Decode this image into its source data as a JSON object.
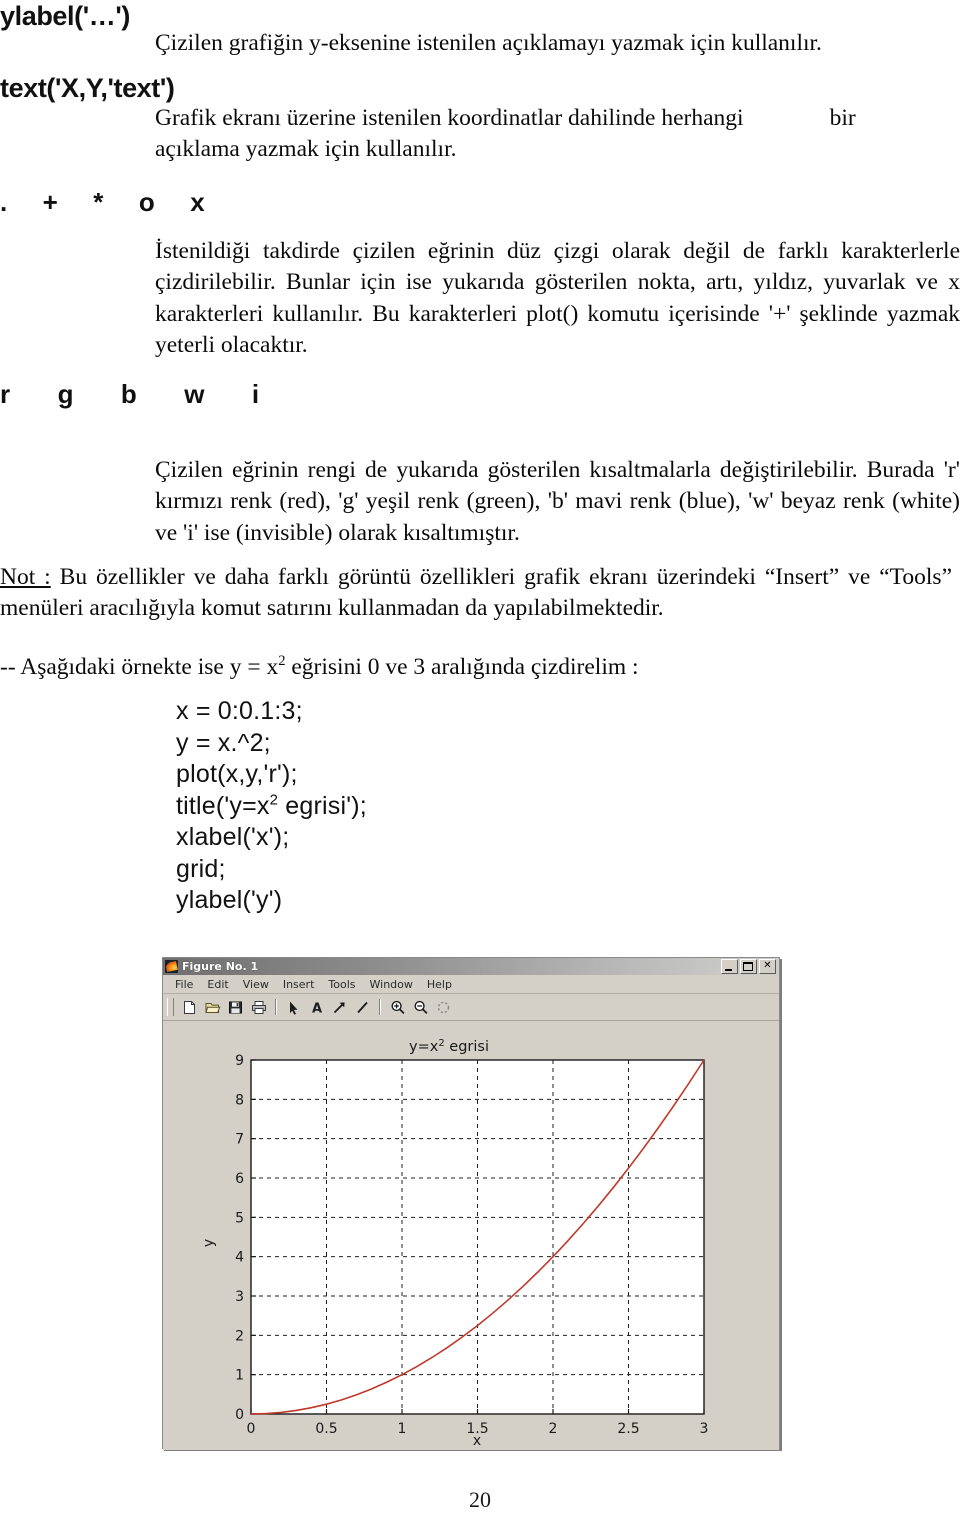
{
  "document": {
    "page_number": "20",
    "sections": [
      {
        "heading": "ylabel('…')",
        "paragraph": "Çizilen grafiğin y-eksenine istenilen açıklamayı yazmak için kullanılır."
      },
      {
        "heading": "text('X,Y,'text')",
        "paragraph_part1": "Grafik ekranı üzerine istenilen koordinatlar dahilinde  herhangi",
        "paragraph_part2": "bir",
        "paragraph_part3": "açıklama yazmak için kullanılır."
      },
      {
        "heading": ".  +  *  o  x",
        "paragraph": "İstenildiği takdirde çizilen eğrinin düz çizgi olarak değil de farklı karakterlerle çizdirilebilir. Bunlar için ise yukarıda gösterilen nokta, artı, yıldız, yuvarlak ve x karakterleri kullanılır. Bu karakterleri plot() komutu içerisinde '+' şeklinde yazmak yeterli olacaktır."
      },
      {
        "heading": "r  g  b  w  i",
        "paragraph": "Çizilen eğrinin rengi de yukarıda gösterilen kısaltmalarla değiştirilebilir. Burada 'r' kırmızı renk (red), 'g' yeşil renk (green), 'b' mavi renk (blue), 'w' beyaz renk (white) ve  'i' ise (invisible) olarak kısaltımıştır."
      }
    ],
    "note": {
      "label": "Not :",
      "text": " Bu özellikler ve daha farklı görüntü özellikleri grafik ekranı üzerindeki “Insert” ve “Tools” menüleri aracılığıyla komut satırını kullanmadan da yapılabilmektedir."
    },
    "example_intro": {
      "before": "-- Aşağıdaki örnekte ise y = x",
      "superscript": "2",
      "after": " eğrisini 0 ve 3 aralığında çizdirelim :"
    },
    "code": [
      {
        "text": "x = 0:0.1:3;"
      },
      {
        "text": "y = x.^2;"
      },
      {
        "text": "plot(x,y,'r');"
      },
      {
        "text": "title('y=x",
        "sup": "2",
        "tail": " egrisi');"
      },
      {
        "text": "xlabel('x');"
      },
      {
        "text": "grid;"
      },
      {
        "text": "ylabel('y')"
      }
    ]
  },
  "figure_window": {
    "title": "Figure No. 1",
    "window_buttons": {
      "minimize": "–",
      "maximize": "□",
      "close": "✕"
    },
    "menus": [
      "File",
      "Edit",
      "View",
      "Insert",
      "Tools",
      "Window",
      "Help"
    ],
    "toolbar_icons": [
      "new-figure-icon",
      "open-file-icon",
      "save-figure-icon",
      "print-figure-icon",
      "pointer-icon",
      "insert-text-icon",
      "insert-arrow-icon",
      "insert-line-icon",
      "zoom-in-icon",
      "zoom-out-icon",
      "rotate-3d-icon"
    ],
    "colors": {
      "window_face": "#d4d0c8",
      "plot_background": "#ffffff",
      "curve": "#c0392b",
      "grid": "#000000"
    }
  },
  "chart_data": {
    "type": "line",
    "title": "y=x² egrisi",
    "title_base": "y=x",
    "title_sup": "2",
    "title_tail": " egrisi",
    "xlabel": "x",
    "ylabel": "y",
    "xlim": [
      0,
      3
    ],
    "ylim": [
      0,
      9
    ],
    "grid": true,
    "legend": null,
    "xticks": [
      "0",
      "0.5",
      "1",
      "1.5",
      "2",
      "2.5",
      "3"
    ],
    "xtick_values": [
      0,
      0.5,
      1,
      1.5,
      2,
      2.5,
      3
    ],
    "yticks": [
      "0",
      "1",
      "2",
      "3",
      "4",
      "5",
      "6",
      "7",
      "8",
      "9"
    ],
    "ytick_values": [
      0,
      1,
      2,
      3,
      4,
      5,
      6,
      7,
      8,
      9
    ],
    "series": [
      {
        "name": "y = x^2",
        "color": "#c0392b",
        "x": [
          0,
          0.1,
          0.2,
          0.3,
          0.4,
          0.5,
          0.6,
          0.7,
          0.8,
          0.9,
          1.0,
          1.1,
          1.2,
          1.3,
          1.4,
          1.5,
          1.6,
          1.7,
          1.8,
          1.9,
          2.0,
          2.1,
          2.2,
          2.3,
          2.4,
          2.5,
          2.6,
          2.7,
          2.8,
          2.9,
          3.0
        ],
        "values": [
          0,
          0.01,
          0.04,
          0.09,
          0.16,
          0.25,
          0.36,
          0.49,
          0.64,
          0.81,
          1.0,
          1.21,
          1.44,
          1.69,
          1.96,
          2.25,
          2.56,
          2.89,
          3.24,
          3.61,
          4.0,
          4.41,
          4.84,
          5.29,
          5.76,
          6.25,
          6.76,
          7.29,
          7.84,
          8.41,
          9.0
        ]
      }
    ]
  }
}
